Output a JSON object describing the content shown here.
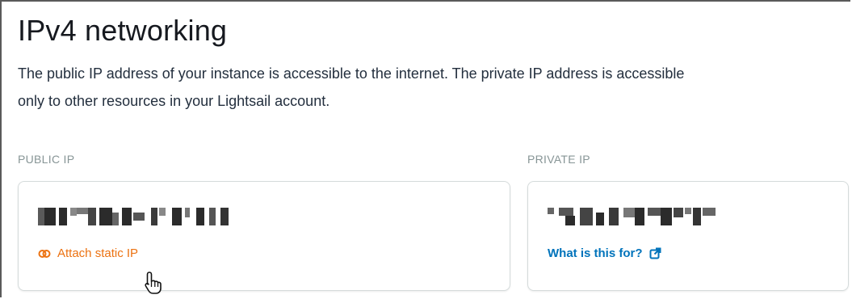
{
  "section": {
    "title": "IPv4 networking",
    "description": "The public IP address of your instance is accessible to the internet. The private IP address is accessible only to other resources in your Lightsail account."
  },
  "public_ip": {
    "label": "PUBLIC IP",
    "value": "",
    "action_label": "Attach static IP",
    "action_icon": "static-ip-link-icon",
    "accent_color": "#ec7211"
  },
  "private_ip": {
    "label": "PRIVATE IP",
    "value": "",
    "action_label": "What is this for?",
    "action_icon": "external-link-icon",
    "accent_color": "#0073bb"
  }
}
